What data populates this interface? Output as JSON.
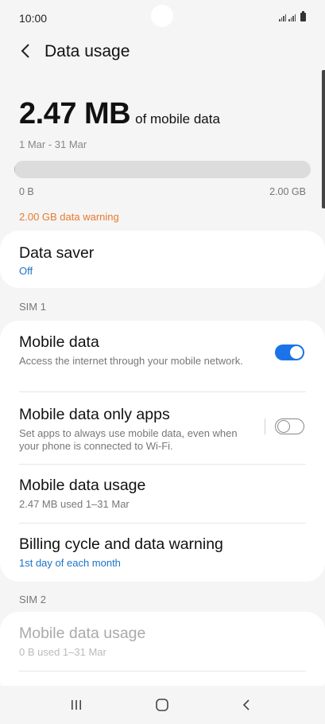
{
  "status_bar": {
    "time": "10:00"
  },
  "header": {
    "title": "Data usage"
  },
  "summary": {
    "amount": "2.47 MB",
    "amount_suffix": "of mobile data",
    "period": "1 Mar - 31 Mar",
    "range_min": "0 B",
    "range_max": "2.00 GB",
    "usage_fraction": 0.0012,
    "warning": "2.00 GB data warning"
  },
  "data_saver": {
    "title": "Data saver",
    "status": "Off"
  },
  "sim1": {
    "label": "SIM 1",
    "mobile_data": {
      "title": "Mobile data",
      "description": "Access the internet through your mobile network.",
      "enabled": true
    },
    "data_only_apps": {
      "title": "Mobile data only apps",
      "description": "Set apps to always use mobile data, even when your phone is connected to Wi-Fi.",
      "enabled": false
    },
    "usage": {
      "title": "Mobile data usage",
      "detail": "2.47 MB used 1–31 Mar"
    },
    "billing": {
      "title": "Billing cycle and data warning",
      "detail": "1st day of each month"
    }
  },
  "sim2": {
    "label": "SIM 2",
    "usage": {
      "title": "Mobile data usage",
      "detail": "0 B used 1–31 Mar"
    }
  },
  "colors": {
    "accent": "#1a73e8",
    "warning": "#e87a2c",
    "link": "#1a73c9"
  },
  "nav": {
    "icons": [
      "recent-apps-icon",
      "home-icon",
      "back-icon"
    ]
  }
}
